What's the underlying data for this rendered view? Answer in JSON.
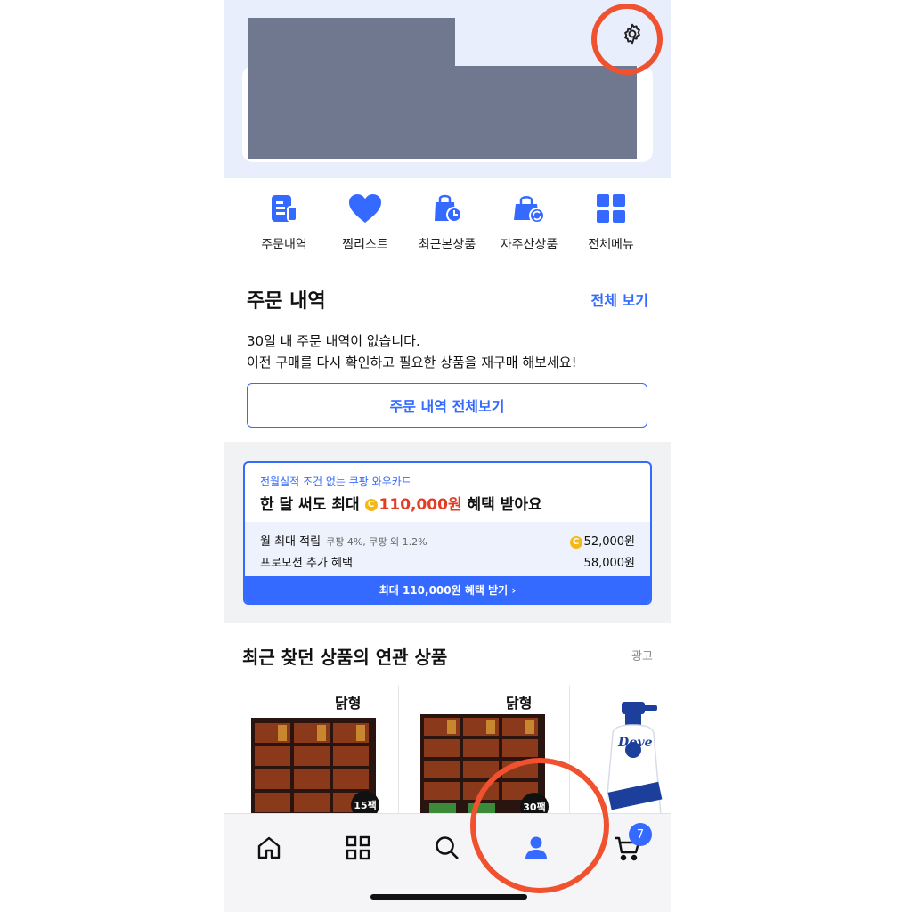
{
  "colors": {
    "accent": "#346aff",
    "price_red": "#e23c25",
    "highlight_circle": "#f0512f",
    "redaction": "#6f788e",
    "header_bg": "#e8eefc"
  },
  "header": {
    "settings_icon": "gear-icon"
  },
  "quick_menu": [
    {
      "label": "주문내역",
      "icon": "receipt-icon"
    },
    {
      "label": "찜리스트",
      "icon": "heart-icon"
    },
    {
      "label": "최근본상품",
      "icon": "shopping-bag-clock-icon"
    },
    {
      "label": "자주산상품",
      "icon": "bag-refresh-icon"
    },
    {
      "label": "전체메뉴",
      "icon": "grid-icon"
    }
  ],
  "orders": {
    "title": "주문 내역",
    "view_all": "전체 보기",
    "empty_line1": "30일 내 주문 내역이 없습니다.",
    "empty_line2": "이전 구매를 다시 확인하고 필요한 상품을 재구매 해보세요!",
    "button": "주문 내역 전체보기"
  },
  "promo": {
    "eyebrow": "전월실적 조건 없는 쿠팡 와우카드",
    "headline_pre": "한 달 써도 최대",
    "headline_amount": "110,000원",
    "headline_post": "혜택 받아요",
    "row1_label": "월 최대 적립",
    "row1_sub": "쿠팡 4%, 쿠팡 외 1.2%",
    "row1_value": "52,000원",
    "row2_label": "프로모션 추가 혜택",
    "row2_value": "58,000원",
    "cta": "최대 110,000원 혜택 받기 ›",
    "coin_symbol": "C"
  },
  "related": {
    "title": "최근 찾던 상품의 연관 상품",
    "ad_label": "광고",
    "products": [
      {
        "brand": "닭형",
        "qty": "15팩"
      },
      {
        "brand": "닭형",
        "qty": "30팩"
      },
      {
        "brand": "Dove"
      }
    ]
  },
  "bottom_nav": {
    "items": [
      "home-icon",
      "category-grid-icon",
      "search-icon",
      "my-page-person-icon",
      "cart-icon"
    ],
    "cart_count": "7"
  }
}
